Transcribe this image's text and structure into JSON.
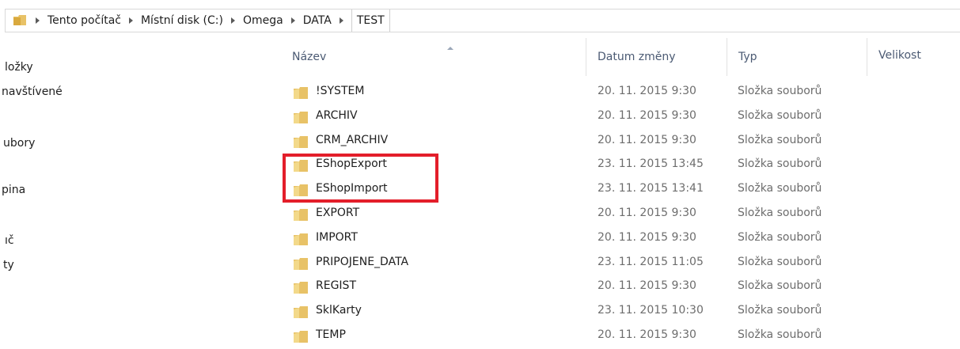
{
  "address_bar": {
    "breadcrumbs": [
      "Tento počítač",
      "Místní disk (C:)",
      "Omega",
      "DATA",
      "TEST"
    ]
  },
  "nav": {
    "items": [
      "ložky",
      "navštívené",
      "ubory",
      "pina",
      "ıč",
      "ty"
    ]
  },
  "columns": {
    "name": "Název",
    "date": "Datum změny",
    "type": "Typ",
    "size": "Velikost"
  },
  "files": [
    {
      "name": "!SYSTEM",
      "date": "20. 11. 2015 9:30",
      "type": "Složka souborů"
    },
    {
      "name": "ARCHIV",
      "date": "20. 11. 2015 9:30",
      "type": "Složka souborů"
    },
    {
      "name": "CRM_ARCHIV",
      "date": "20. 11. 2015 9:30",
      "type": "Složka souborů"
    },
    {
      "name": "EShopExport",
      "date": "23. 11. 2015 13:45",
      "type": "Složka souborů"
    },
    {
      "name": "EShopImport",
      "date": "23. 11. 2015 13:41",
      "type": "Složka souborů"
    },
    {
      "name": "EXPORT",
      "date": "20. 11. 2015 9:30",
      "type": "Složka souborů"
    },
    {
      "name": "IMPORT",
      "date": "20. 11. 2015 9:30",
      "type": "Složka souborů"
    },
    {
      "name": "PRIPOJENE_DATA",
      "date": "23. 11. 2015 11:05",
      "type": "Složka souborů"
    },
    {
      "name": "REGIST",
      "date": "20. 11. 2015 9:30",
      "type": "Složka souborů"
    },
    {
      "name": "SklKarty",
      "date": "23. 11. 2015 10:30",
      "type": "Složka souborů"
    },
    {
      "name": "TEMP",
      "date": "20. 11. 2015 9:30",
      "type": "Složka souborů"
    }
  ],
  "colors": {
    "highlight": "#e31e2a",
    "folder": "#e8c267",
    "header_text": "#4b5a73"
  }
}
